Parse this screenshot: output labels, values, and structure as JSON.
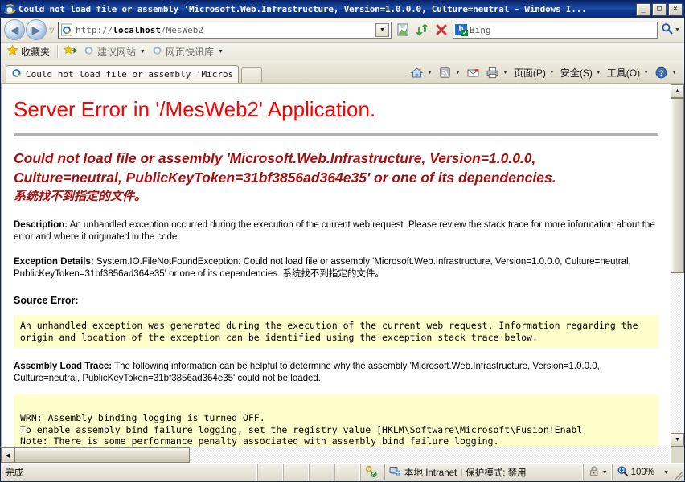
{
  "window": {
    "title": "Could not load file or assembly 'Microsoft.Web.Infrastructure, Version=1.0.0.0, Culture=neutral - Windows I...",
    "minimize_label": "_",
    "maximize_label": "□",
    "close_label": "✕"
  },
  "navbar": {
    "back_label": "◀",
    "forward_label": "▶",
    "history_caret": "▽",
    "url_scheme": "http://",
    "url_host": "localhost",
    "url_path": "/MesWeb2",
    "url_full": "http://localhost/MesWeb2",
    "dropdown_caret": "▼",
    "compat_label": "compatibility-view",
    "refresh_label": "↻",
    "stop_label": "✕",
    "search_engine": "b",
    "search_placeholder": "Bing",
    "search_go_label": "⌕",
    "search_caret": "▼"
  },
  "favorites_bar": {
    "favorites_label": "收藏夹",
    "items": [
      {
        "label": "建议网站",
        "caret": "▼"
      },
      {
        "label": "网页快讯库",
        "caret": "▼"
      }
    ]
  },
  "tabs": {
    "items": [
      {
        "label": "Could not load file or assembly 'Microsof..."
      }
    ],
    "new_tab_label": ""
  },
  "command_bar": {
    "items": [
      {
        "name": "home",
        "label": "",
        "caret": "▼"
      },
      {
        "name": "feeds",
        "label": "",
        "caret": "▼"
      },
      {
        "name": "mail",
        "label": "",
        "caret": ""
      },
      {
        "name": "print",
        "label": "",
        "caret": "▼"
      },
      {
        "name": "page",
        "label": "页面(P)",
        "caret": "▼"
      },
      {
        "name": "safety",
        "label": "安全(S)",
        "caret": "▼"
      },
      {
        "name": "tools",
        "label": "工具(O)",
        "caret": "▼"
      },
      {
        "name": "help",
        "label": "",
        "caret": "▼"
      }
    ]
  },
  "page": {
    "title": "Server Error in '/MesWeb2' Application.",
    "error_message_line1": "Could not load file or assembly 'Microsoft.Web.Infrastructure, Version=1.0.0.0,",
    "error_message_line2": "Culture=neutral, PublicKeyToken=31bf3856ad364e35' or one of its dependencies.",
    "error_message_cn": "系统找不到指定的文件。",
    "description_label": "Description:",
    "description_text": " An unhandled exception occurred during the execution of the current web request. Please review the stack trace for more information about the error and where it originated in the code.",
    "exception_details_label": "Exception Details:",
    "exception_details_text": " System.IO.FileNotFoundException: Could not load file or assembly 'Microsoft.Web.Infrastructure, Version=1.0.0.0, Culture=neutral, PublicKeyToken=31bf3856ad364e35' or one of its dependencies. 系统找不到指定的文件。",
    "source_error_label": "Source Error:",
    "source_error_code": "An unhandled exception was generated during the execution of the current web request. Information regarding the\norigin and location of the exception can be identified using the exception stack trace below.",
    "assembly_load_trace_label": "Assembly Load Trace:",
    "assembly_load_trace_text": " The following information can be helpful to determine why the assembly 'Microsoft.Web.Infrastructure, Version=1.0.0.0, Culture=neutral, PublicKeyToken=31bf3856ad364e35' could not be loaded.",
    "trace_code": "WRN: Assembly binding logging is turned OFF.\nTo enable assembly bind failure logging, set the registry value [HKLM\\Software\\Microsoft\\Fusion!Enabl\nNote: There is some performance penalty associated with assembly bind failure logging."
  },
  "scrollbars": {
    "v_up_label": "▲",
    "v_down_label": "▼",
    "h_left_label": "◀",
    "h_right_label": "▶"
  },
  "statusbar": {
    "status_text": "完成",
    "zone_text": "本地 Intranet",
    "separator": "|",
    "protected_mode_text": "保护模式: 禁用",
    "zoom_level": "100%",
    "zoom_caret": "▼",
    "privacy_caret": "▼"
  },
  "colors": {
    "title_red": "#ff0000",
    "message_red": "#a50f0f",
    "code_background": "#ffffcc",
    "titlebar_blue": "#0a246a"
  }
}
